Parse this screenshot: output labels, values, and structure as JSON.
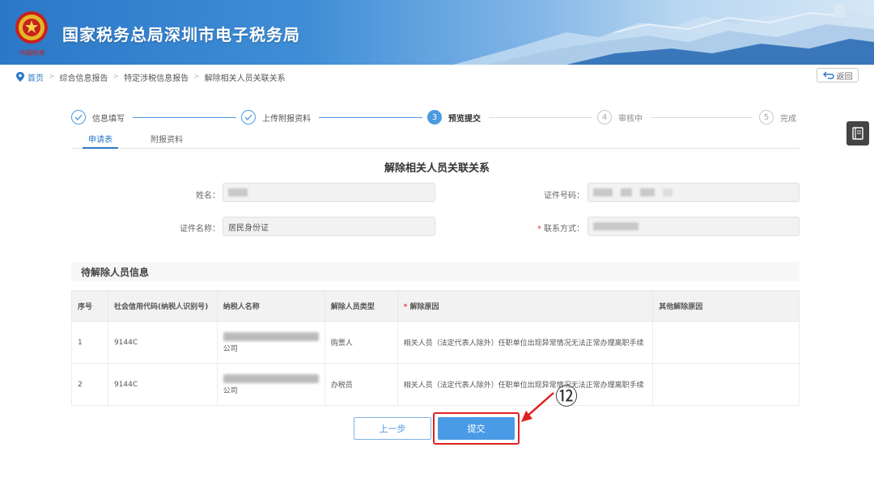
{
  "header": {
    "site_title": "国家税务总局深圳市电子税务局",
    "emblem_caption": "中国税务"
  },
  "breadcrumb": {
    "items": [
      "首页",
      "综合信息报告",
      "特定涉税信息报告",
      "解除相关人员关联关系"
    ],
    "back_label": "返回"
  },
  "steps": [
    {
      "num": "",
      "label": "信息填写",
      "state": "done"
    },
    {
      "num": "",
      "label": "上传附报资料",
      "state": "done"
    },
    {
      "num": "3",
      "label": "预览提交",
      "state": "active"
    },
    {
      "num": "4",
      "label": "审核中",
      "state": "todo"
    },
    {
      "num": "5",
      "label": "完成",
      "state": "todo"
    }
  ],
  "subtabs": [
    "申请表",
    "附报资料"
  ],
  "form": {
    "title": "解除相关人员关联关系",
    "name_label": "姓名：",
    "id_number_label": "证件号码：",
    "id_type_label": "证件名称：",
    "id_type_value": "居民身份证",
    "contact_label": "联系方式：",
    "required_mark": "*"
  },
  "section": {
    "title": "待解除人员信息"
  },
  "table": {
    "headers": [
      "序号",
      "社会信用代码(纳税人识别号)",
      "纳税人名称",
      "解除人员类型",
      "解除原因",
      "其他解除原因"
    ],
    "rows": [
      {
        "index": "1",
        "code": "9144C",
        "company_suffix": "公司",
        "type": "购票人",
        "reason": "相关人员（法定代表人除外）任职单位出现异常情况无法正常办理离职手续",
        "other": ""
      },
      {
        "index": "2",
        "code": "9144C",
        "company_suffix": "公司",
        "type": "办税员",
        "reason": "相关人员（法定代表人除外）任职单位出现异常情况无法正常办理离职手续",
        "other": ""
      }
    ]
  },
  "buttons": {
    "prev_label": "上一步",
    "submit_label": "提交"
  },
  "annotation": {
    "label": "⑫"
  },
  "colors": {
    "accent": "#4a9be6",
    "highlight": "#e02020",
    "header_blue": "#2b78c8"
  }
}
